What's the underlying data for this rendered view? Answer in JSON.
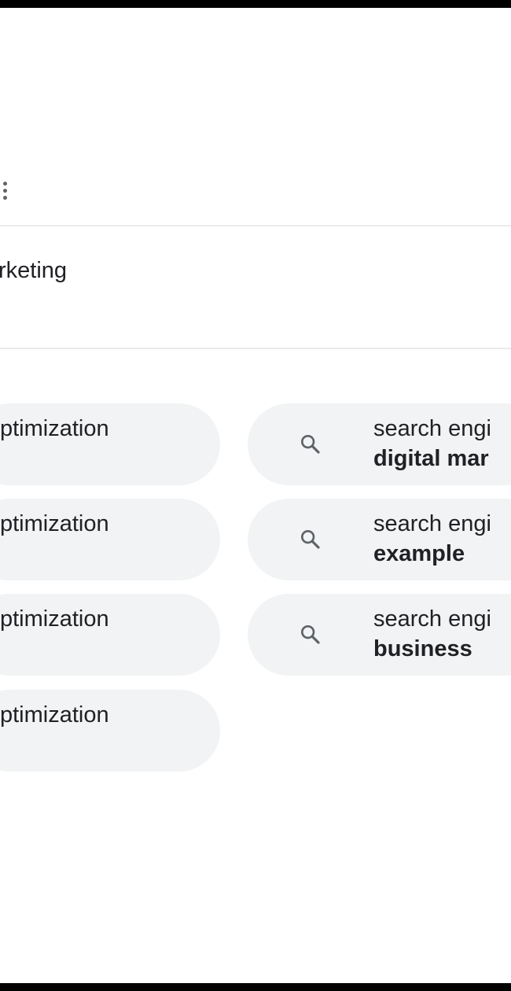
{
  "header": {
    "menu_icon": "more-vert-icon"
  },
  "search": {
    "query_fragment": "rketing"
  },
  "related": {
    "left_chips": [
      {
        "line1": "ptimization"
      },
      {
        "line1": "ptimization"
      },
      {
        "line1": "ptimization"
      },
      {
        "line1": "ptimization"
      }
    ],
    "right_chips": [
      {
        "line1": "search engi",
        "line2": "digital mar",
        "icon": "search-icon"
      },
      {
        "line1": "search engi",
        "line2": "example",
        "icon": "search-icon"
      },
      {
        "line1": "search engi",
        "line2": "business",
        "icon": "search-icon"
      }
    ]
  },
  "colors": {
    "chip_background": "#f1f3f4",
    "text": "#202124",
    "icon": "#5f6368",
    "divider": "#ebebeb",
    "frame": "#000000"
  }
}
